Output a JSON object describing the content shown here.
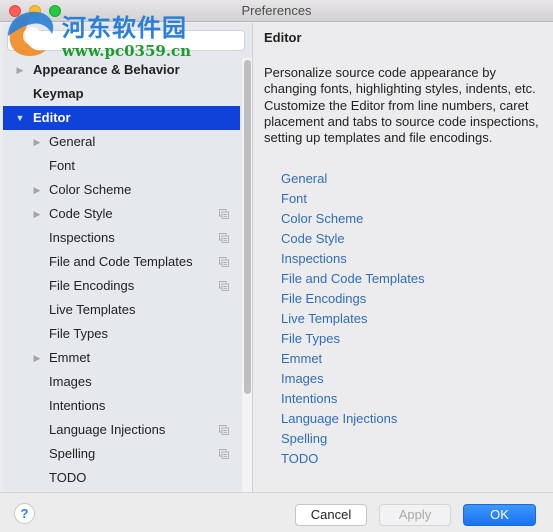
{
  "window": {
    "title": "Preferences"
  },
  "watermark": {
    "site_name": "河东软件园",
    "url": "www.pc0359.cn"
  },
  "search": {
    "value": "",
    "placeholder": ""
  },
  "tree": {
    "items": [
      {
        "label": "Appearance & Behavior",
        "level": 0,
        "arrow": "collapsed",
        "project_icon": false,
        "selected": false
      },
      {
        "label": "Keymap",
        "level": 0,
        "arrow": "none",
        "project_icon": false,
        "selected": false
      },
      {
        "label": "Editor",
        "level": 0,
        "arrow": "expanded",
        "project_icon": false,
        "selected": true
      },
      {
        "label": "General",
        "level": 1,
        "arrow": "collapsed",
        "project_icon": false,
        "selected": false
      },
      {
        "label": "Font",
        "level": 1,
        "arrow": "none",
        "project_icon": false,
        "selected": false
      },
      {
        "label": "Color Scheme",
        "level": 1,
        "arrow": "collapsed",
        "project_icon": false,
        "selected": false
      },
      {
        "label": "Code Style",
        "level": 1,
        "arrow": "collapsed",
        "project_icon": true,
        "selected": false
      },
      {
        "label": "Inspections",
        "level": 1,
        "arrow": "none",
        "project_icon": true,
        "selected": false
      },
      {
        "label": "File and Code Templates",
        "level": 1,
        "arrow": "none",
        "project_icon": true,
        "selected": false
      },
      {
        "label": "File Encodings",
        "level": 1,
        "arrow": "none",
        "project_icon": true,
        "selected": false
      },
      {
        "label": "Live Templates",
        "level": 1,
        "arrow": "none",
        "project_icon": false,
        "selected": false
      },
      {
        "label": "File Types",
        "level": 1,
        "arrow": "none",
        "project_icon": false,
        "selected": false
      },
      {
        "label": "Emmet",
        "level": 1,
        "arrow": "collapsed",
        "project_icon": false,
        "selected": false
      },
      {
        "label": "Images",
        "level": 1,
        "arrow": "none",
        "project_icon": false,
        "selected": false
      },
      {
        "label": "Intentions",
        "level": 1,
        "arrow": "none",
        "project_icon": false,
        "selected": false
      },
      {
        "label": "Language Injections",
        "level": 1,
        "arrow": "none",
        "project_icon": true,
        "selected": false
      },
      {
        "label": "Spelling",
        "level": 1,
        "arrow": "none",
        "project_icon": true,
        "selected": false
      },
      {
        "label": "TODO",
        "level": 1,
        "arrow": "none",
        "project_icon": false,
        "selected": false
      }
    ]
  },
  "content": {
    "title": "Editor",
    "description": "Personalize source code appearance by changing fonts, highlighting styles, indents, etc. Customize the Editor from line numbers, caret placement and tabs to source code inspections, setting up templates and file encodings.",
    "links": [
      "General",
      "Font",
      "Color Scheme",
      "Code Style",
      "Inspections",
      "File and Code Templates",
      "File Encodings",
      "Live Templates",
      "File Types",
      "Emmet",
      "Images",
      "Intentions",
      "Language Injections",
      "Spelling",
      "TODO"
    ]
  },
  "footer": {
    "help_label": "?",
    "cancel_label": "Cancel",
    "apply_label": "Apply",
    "ok_label": "OK",
    "apply_enabled": false
  },
  "colors": {
    "selection": "#0f42d8",
    "link": "#2f6eb8",
    "ok_button": "#1a72f0"
  },
  "icons": {
    "collapsed": "▶",
    "expanded": "▼"
  }
}
